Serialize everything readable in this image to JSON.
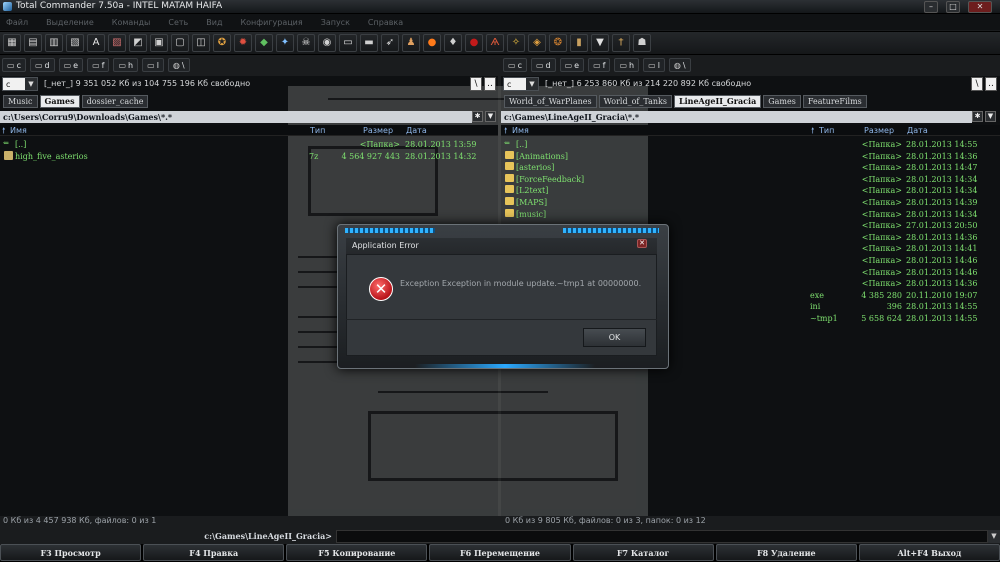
{
  "window": {
    "title": "Total Commander 7.50a - INTEL MATAM HAIFA"
  },
  "menu": [
    "Файл",
    "Выделение",
    "Команды",
    "Сеть",
    "Вид",
    "Конфигурация",
    "Запуск",
    "Справка"
  ],
  "toolbar": {
    "icons": [
      {
        "name": "refresh-icon",
        "glyph": "▦",
        "color": "#d0d0d0"
      },
      {
        "name": "brief-view-icon",
        "glyph": "▤",
        "color": "#d0d0d0"
      },
      {
        "name": "full-view-icon",
        "glyph": "▥",
        "color": "#d0d0d0"
      },
      {
        "name": "tree-icon",
        "glyph": "▧",
        "color": "#d0d0d0"
      },
      {
        "name": "sort-name-icon",
        "glyph": "A",
        "color": "#e8e8e8"
      },
      {
        "name": "sort-ext-icon",
        "glyph": "▨",
        "color": "#d07070"
      },
      {
        "name": "invert-icon",
        "glyph": "◩",
        "color": "#d0d0d0"
      },
      {
        "name": "pack-icon",
        "glyph": "▣",
        "color": "#d0d0d0"
      },
      {
        "name": "unpack-icon",
        "glyph": "▢",
        "color": "#d0d0d0"
      },
      {
        "name": "compare-icon",
        "glyph": "◫",
        "color": "#d0d0d0"
      },
      {
        "name": "game-icon-1",
        "glyph": "✪",
        "color": "#e0a040"
      },
      {
        "name": "game-icon-2",
        "glyph": "✹",
        "color": "#e05040"
      },
      {
        "name": "game-icon-3",
        "glyph": "◆",
        "color": "#60c060"
      },
      {
        "name": "spark-icon",
        "glyph": "✦",
        "color": "#80c0ff"
      },
      {
        "name": "skull-icon",
        "glyph": "☠",
        "color": "#e0e0e0"
      },
      {
        "name": "disc-icon",
        "glyph": "◉",
        "color": "#d0d0d0"
      },
      {
        "name": "monitor-icon",
        "glyph": "▭",
        "color": "#e0e0e0"
      },
      {
        "name": "window-icon",
        "glyph": "▬",
        "color": "#d0d0d0"
      },
      {
        "name": "bird-icon",
        "glyph": "➶",
        "color": "#e0e0e0"
      },
      {
        "name": "person-icon",
        "glyph": "♟",
        "color": "#e0a060"
      },
      {
        "name": "flame-icon",
        "glyph": "●",
        "color": "#ff7a1a"
      },
      {
        "name": "drop-icon",
        "glyph": "♦",
        "color": "#cfcfcf"
      },
      {
        "name": "orb-icon",
        "glyph": "●",
        "color": "#c21a1a"
      },
      {
        "name": "rune-icon",
        "glyph": "Ѧ",
        "color": "#e05a3a"
      },
      {
        "name": "star-icon",
        "glyph": "✧",
        "color": "#f0c040"
      },
      {
        "name": "shield-icon",
        "glyph": "◈",
        "color": "#e0a040"
      },
      {
        "name": "crest-icon",
        "glyph": "❂",
        "color": "#d08030"
      },
      {
        "name": "book-icon",
        "glyph": "▮",
        "color": "#c8a060"
      },
      {
        "name": "cup-icon",
        "glyph": "▼",
        "color": "#e0e0e0"
      },
      {
        "name": "sword-icon",
        "glyph": "†",
        "color": "#e0b060"
      },
      {
        "name": "ghost-icon",
        "glyph": "☗",
        "color": "#d0d0d0"
      }
    ]
  },
  "drives": [
    {
      "letter": "c"
    },
    {
      "letter": "d"
    },
    {
      "letter": "e"
    },
    {
      "letter": "f"
    },
    {
      "letter": "h"
    },
    {
      "letter": "l"
    },
    {
      "letter": "\\"
    }
  ],
  "left": {
    "drive": "c",
    "drive_label": "[_нет_]",
    "free": "9 351 052 Кб из 104 755 196 Кб свободно",
    "tabs": [
      {
        "label": "Music",
        "active": false
      },
      {
        "label": "Games",
        "active": true
      },
      {
        "label": "dossier_cache",
        "active": false
      }
    ],
    "path": "c:\\Users\\Corru9\\Downloads\\Games\\*.*",
    "headers": {
      "name": "Имя",
      "type": "Тип",
      "size": "Размер",
      "date": "Дата"
    },
    "rows": [
      {
        "name": "[..]",
        "ext": "",
        "size": "<Папка>",
        "date": "28.01.2013 13:59",
        "kind": "up"
      },
      {
        "name": "high_five_asterios",
        "ext": "7z",
        "size": "4 564 927 443",
        "date": "28.01.2013 14:32",
        "kind": "file"
      }
    ],
    "status": "0 Кб из 4 457 938 Кб, файлов: 0 из 1"
  },
  "right": {
    "drive": "c",
    "drive_label": "[_нет_]",
    "free": "6 253 860 Кб из 214 220 892 Кб свободно",
    "tabs": [
      {
        "label": "World_of_WarPlanes",
        "active": false
      },
      {
        "label": "World_of_Tanks",
        "active": false
      },
      {
        "label": "LineAgeII_Gracia",
        "active": true
      },
      {
        "label": "Games",
        "active": false
      },
      {
        "label": "FeatureFilms",
        "active": false
      }
    ],
    "path": "c:\\Games\\LineAgeII_Gracia\\*.*",
    "headers": {
      "name": "Имя",
      "type": "Тип",
      "size": "Размер",
      "date": "Дата"
    },
    "rows": [
      {
        "name": "[..]",
        "ext": "",
        "size": "<Папка>",
        "date": "28.01.2013 14:55",
        "kind": "up"
      },
      {
        "name": "[Animations]",
        "ext": "",
        "size": "<Папка>",
        "date": "28.01.2013 14:36",
        "kind": "folder"
      },
      {
        "name": "[asterios]",
        "ext": "",
        "size": "<Папка>",
        "date": "28.01.2013 14:47",
        "kind": "folder"
      },
      {
        "name": "[ForceFeedback]",
        "ext": "",
        "size": "<Папка>",
        "date": "28.01.2013 14:34",
        "kind": "folder"
      },
      {
        "name": "[L2text]",
        "ext": "",
        "size": "<Папка>",
        "date": "28.01.2013 14:34",
        "kind": "folder"
      },
      {
        "name": "[MAPS]",
        "ext": "",
        "size": "<Папка>",
        "date": "28.01.2013 14:39",
        "kind": "folder"
      },
      {
        "name": "[music]",
        "ext": "",
        "size": "<Папка>",
        "date": "28.01.2013 14:34",
        "kind": "folder"
      },
      {
        "name": "",
        "ext": "",
        "size": "<Папка>",
        "date": "27.01.2013 20:50",
        "kind": "hidden"
      },
      {
        "name": "",
        "ext": "",
        "size": "<Папка>",
        "date": "28.01.2013 14:36",
        "kind": "hidden"
      },
      {
        "name": "",
        "ext": "",
        "size": "<Папка>",
        "date": "28.01.2013 14:41",
        "kind": "hidden"
      },
      {
        "name": "",
        "ext": "",
        "size": "<Папка>",
        "date": "28.01.2013 14:46",
        "kind": "hidden"
      },
      {
        "name": "",
        "ext": "",
        "size": "<Папка>",
        "date": "28.01.2013 14:46",
        "kind": "hidden"
      },
      {
        "name": "",
        "ext": "",
        "size": "<Папка>",
        "date": "28.01.2013 14:36",
        "kind": "hidden"
      },
      {
        "name": "",
        "ext": "exe",
        "size": "4 385 280",
        "date": "20.11.2010 19:07",
        "kind": "hidden"
      },
      {
        "name": "",
        "ext": "ini",
        "size": "396",
        "date": "28.01.2013 14:55",
        "kind": "hidden"
      },
      {
        "name": "",
        "ext": "~tmp1",
        "size": "5 658 624",
        "date": "28.01.2013 14:55",
        "kind": "hidden"
      }
    ],
    "status": "0 Кб из 9 805 Кб, файлов: 0 из 3, папок: 0 из 12"
  },
  "commandline": {
    "label": "c:\\Games\\LineAgeII_Gracia>",
    "value": ""
  },
  "fkeys": [
    "F3 Просмотр",
    "F4 Правка",
    "F5 Копирование",
    "F6 Перемещение",
    "F7 Каталог",
    "F8 Удаление",
    "Alt+F4 Выход"
  ],
  "dialog": {
    "title": "Application Error",
    "message": "Exception Exception in module update.~tmp1 at 00000000.",
    "ok_label": "OK",
    "icon": "error-icon"
  }
}
